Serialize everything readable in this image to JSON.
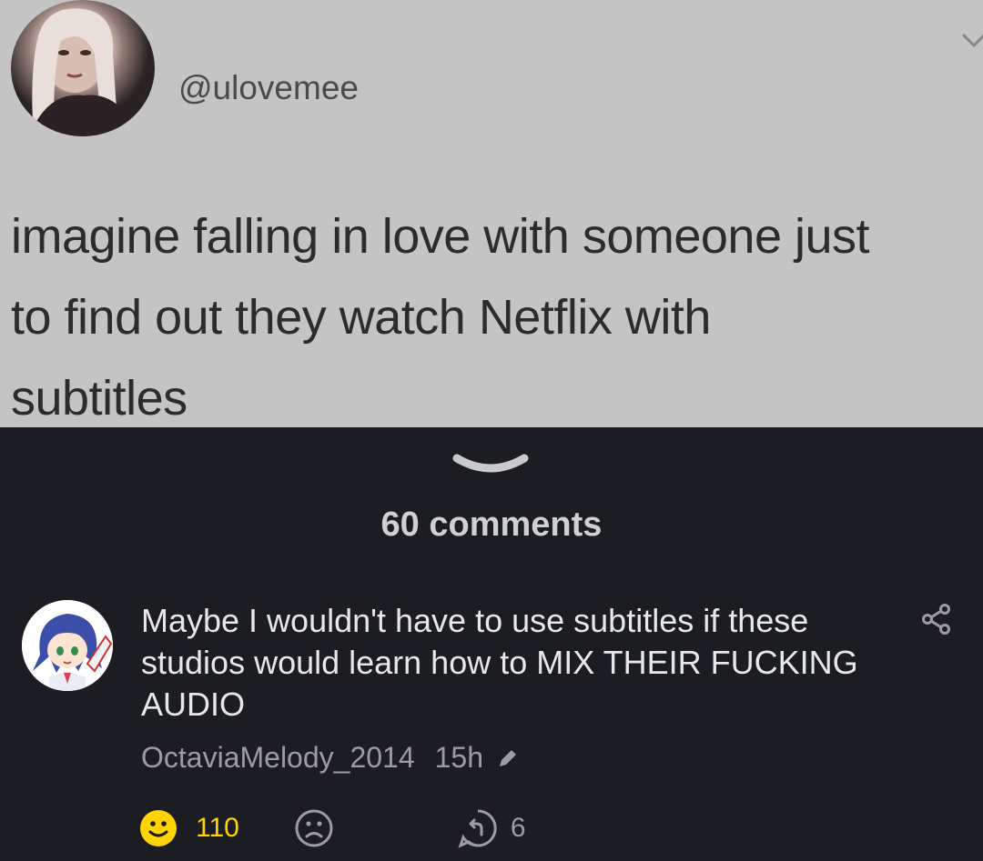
{
  "post": {
    "tweet": {
      "handle": "@ulovemee",
      "text": "imagine falling in love with someone just\nto find out they watch Netflix with\nsubtitles"
    }
  },
  "comments_header": {
    "count_label": "60 comments"
  },
  "comment": {
    "text": "Maybe I wouldn't have to use subtitles if these studios would learn how to MIX THEIR FUCKING AUDIO",
    "author": "OctaviaMelody_2014",
    "time": "15h",
    "likes": "110",
    "replies": "6"
  },
  "icons": {
    "collapse": "chevron-down-icon",
    "share": "share-icon",
    "edit": "pencil-icon",
    "like": "smile-icon",
    "dislike": "frown-icon",
    "reply": "reply-icon"
  },
  "colors": {
    "background": "#1c1d22",
    "post_background": "#c4c4c4",
    "like_accent": "#ffd400",
    "meta_text": "#9c9da4"
  }
}
